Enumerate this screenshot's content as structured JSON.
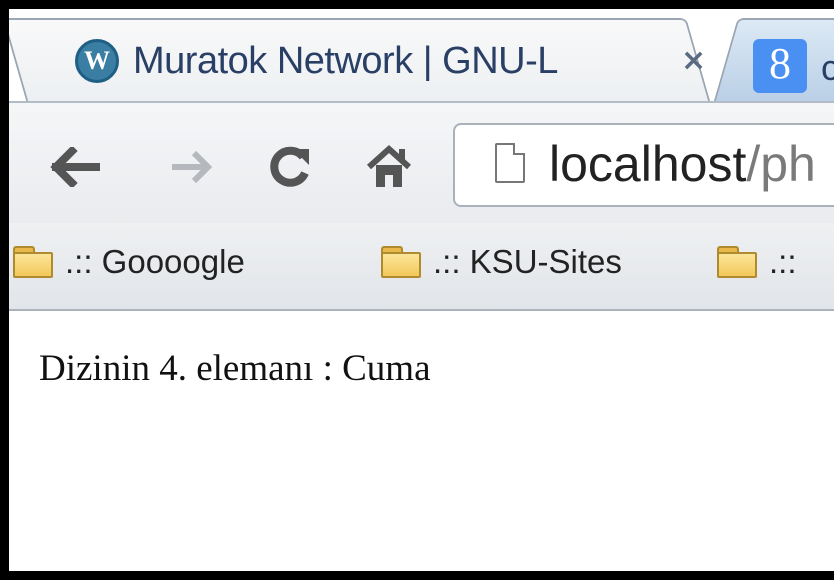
{
  "tabs": [
    {
      "title": "Muratok Network | GNU-L",
      "close_glyph": "×",
      "icon": "wordpress-icon"
    },
    {
      "title": "c",
      "icon": "google-icon",
      "icon_letter": "8"
    }
  ],
  "toolbar": {
    "back_icon": "back-arrow-icon",
    "forward_icon": "forward-arrow-icon",
    "reload_icon": "reload-icon",
    "home_icon": "home-icon",
    "address": {
      "host": "localhost",
      "rest": "/ph"
    }
  },
  "bookmarks": [
    {
      "label": ".:: Goooogle",
      "icon": "folder-icon"
    },
    {
      "label": ".:: KSU-Sites",
      "icon": "folder-icon"
    },
    {
      "label": ".::",
      "icon": "folder-icon"
    }
  ],
  "page": {
    "text": "Dizinin 4. elemanı : Cuma"
  },
  "colors": {
    "accent": "#4a8ff2",
    "tab_text": "#2a3f66",
    "folder": "#f3c85a"
  }
}
